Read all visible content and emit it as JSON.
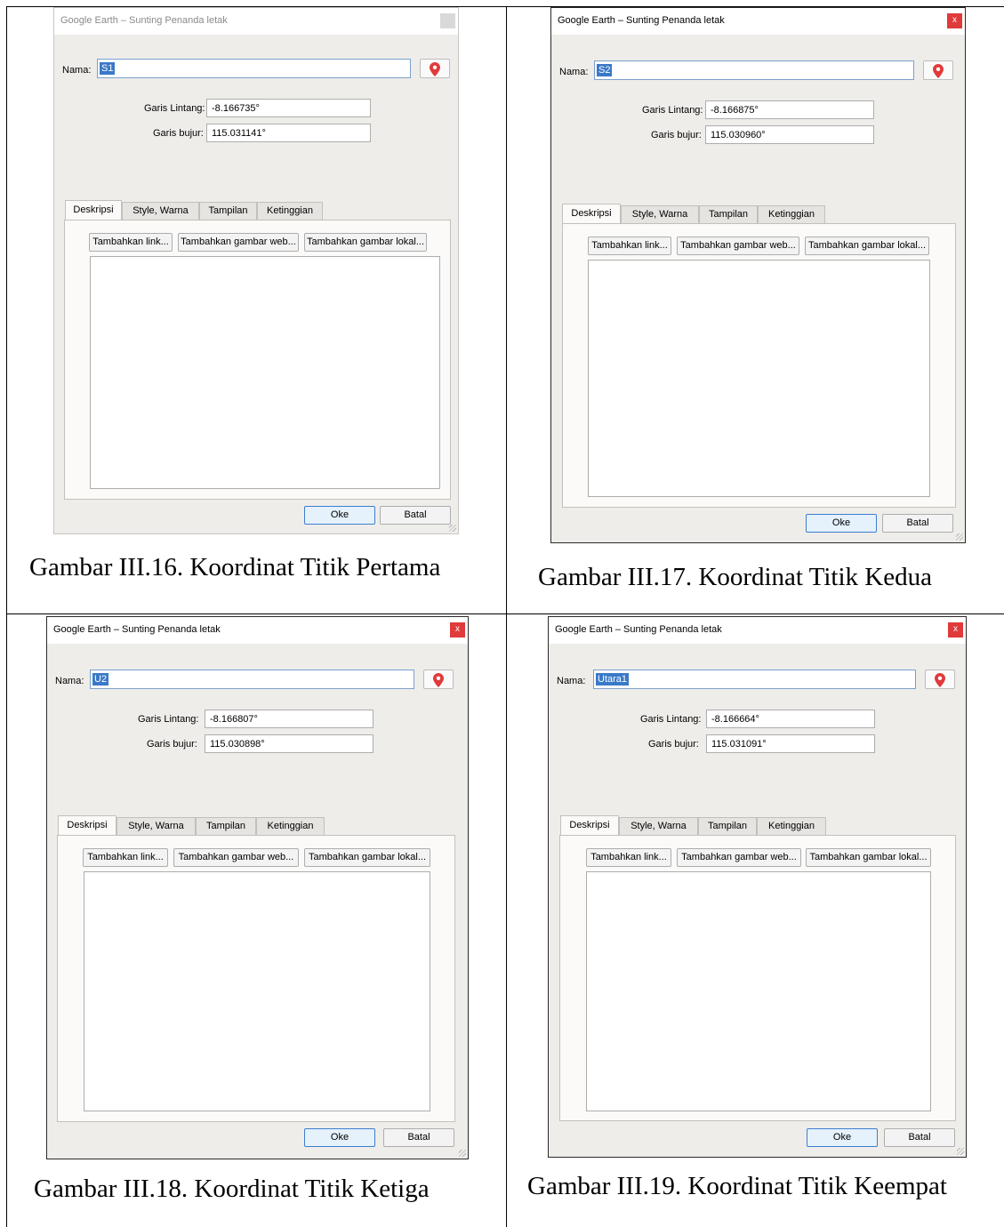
{
  "dialog_title": "Google Earth – Sunting Penanda letak",
  "close_glyph": "x",
  "name_label": "Nama:",
  "lat_label": "Garis Lintang:",
  "lon_label": "Garis bujur:",
  "tabs": [
    "Deskripsi",
    "Style, Warna",
    "Tampilan",
    "Ketinggian"
  ],
  "panel_buttons": [
    "Tambahkan link...",
    "Tambahkan gambar web...",
    "Tambahkan gambar lokal..."
  ],
  "ok_label": "Oke",
  "cancel_label": "Batal",
  "pin_icon": "placemark-pin-icon",
  "accent_color": "#e03a3a",
  "figures": [
    {
      "name": "S1",
      "latitude": "-8.166735°",
      "longitude": "115.031141°",
      "caption": "Gambar III.16. Koordinat Titik Pertama"
    },
    {
      "name": "S2",
      "latitude": "-8.166875°",
      "longitude": "115.030960°",
      "caption": "Gambar III.17. Koordinat Titik Kedua"
    },
    {
      "name": "U2",
      "latitude": "-8.166807°",
      "longitude": "115.030898°",
      "caption": "Gambar III.18. Koordinat Titik Ketiga"
    },
    {
      "name": "Utara1",
      "latitude": "-8.166664°",
      "longitude": "115.031091°",
      "caption": "Gambar III.19. Koordinat Titik Keempat"
    }
  ]
}
